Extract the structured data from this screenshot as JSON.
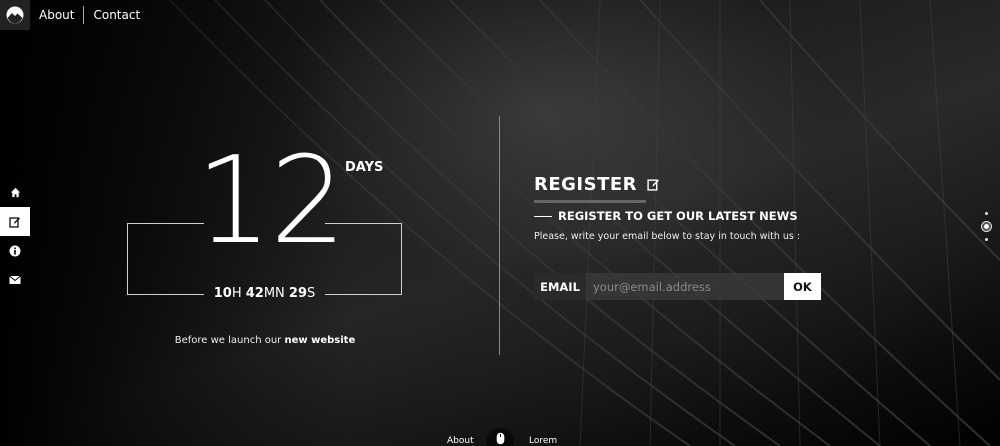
{
  "nav": {
    "about": "About",
    "contact": "Contact"
  },
  "logo_icon": "mountain-logo-icon",
  "sidebar": {
    "items": [
      {
        "icon": "home-icon",
        "active": false
      },
      {
        "icon": "edit-icon",
        "active": true
      },
      {
        "icon": "info-icon",
        "active": false
      },
      {
        "icon": "mail-icon",
        "active": false
      }
    ]
  },
  "countdown": {
    "days": "12",
    "days_label": "DAYS",
    "hours": "10",
    "hours_unit": "H",
    "minutes": "42",
    "minutes_unit": "MN",
    "seconds": "29",
    "seconds_unit": "S",
    "launch_prefix": "Before we launch our",
    "launch_emphasis": "new website"
  },
  "register": {
    "title": "REGISTER",
    "subtitle": "REGISTER TO GET OUR LATEST NEWS",
    "description": "Please, write your email below to stay in touch with us :",
    "email_label": "EMAIL",
    "email_placeholder": "your@email.address",
    "email_value": "",
    "ok_label": "OK"
  },
  "bottom": {
    "about": "About",
    "lorem": "Lorem"
  },
  "colors": {
    "background": "#000000",
    "text": "#ffffff",
    "input_bg": "#3c3c3c",
    "accent": "#ffffff"
  }
}
